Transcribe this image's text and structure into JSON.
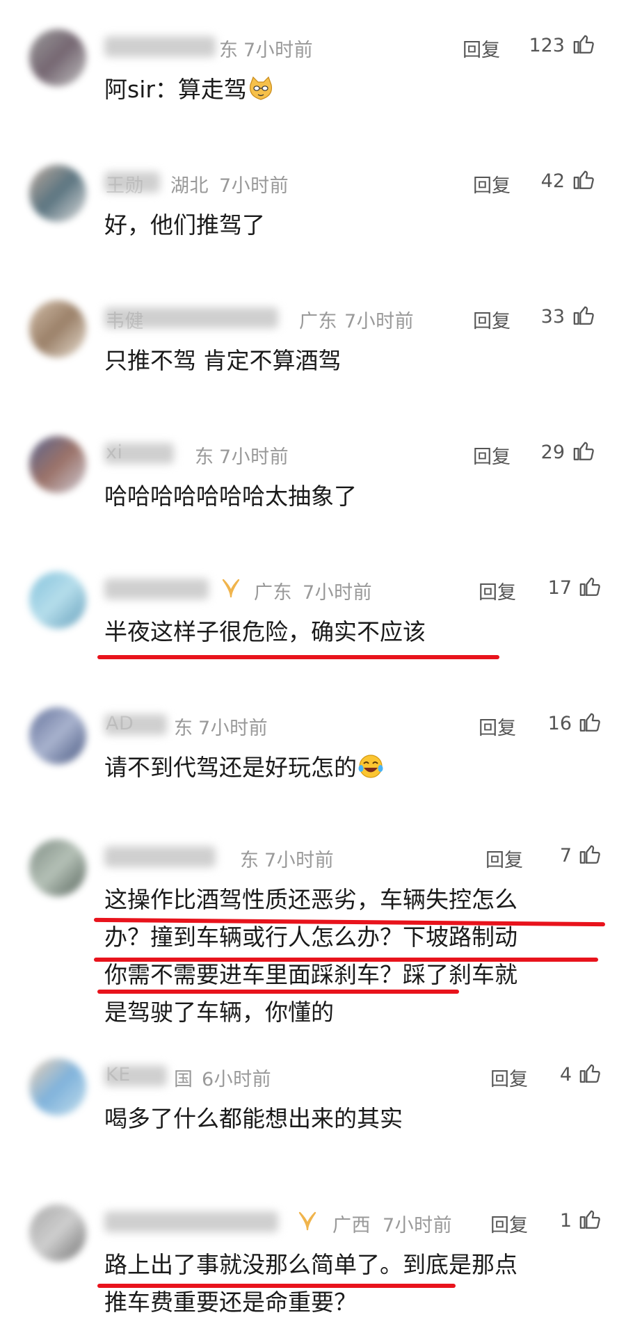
{
  "reply_label": "回复",
  "comments": [
    {
      "region": "东",
      "time": "7小时前",
      "likes": "123",
      "text": "阿sir：算走驾"
    },
    {
      "name_part": "王勋",
      "region": "湖北",
      "time": "7小时前",
      "likes": "42",
      "text": "好，他们推驾了"
    },
    {
      "name_part": "韦健",
      "region": "广东",
      "time": "7小时前",
      "likes": "33",
      "text": "只推不驾 肯定不算酒驾"
    },
    {
      "name_part": "xi",
      "region": "东",
      "time": "7小时前",
      "likes": "29",
      "text": "哈哈哈哈哈哈哈太抽象了"
    },
    {
      "region": "广东",
      "time": "7小时前",
      "likes": "17",
      "text": "半夜这样子很危险，确实不应该",
      "badge_icon": "vip-badge-icon"
    },
    {
      "name_part": "AD",
      "region": "东",
      "time": "7小时前",
      "likes": "16",
      "text": "请不到代驾还是好玩怎的"
    },
    {
      "region": "东",
      "time": "7小时前",
      "likes": "7",
      "text_lines": [
        "这操作比酒驾性质还恶劣，车辆失控怎么",
        "办？撞到车辆或行人怎么办？下坡路制动",
        "你需不需要进车里面踩刹车？踩了刹车就",
        "是驾驶了车辆，你懂的"
      ]
    },
    {
      "name_part": "KE",
      "region": "国",
      "time": "6小时前",
      "likes": "4",
      "text": "喝多了什么都能想出来的其实"
    },
    {
      "region": "广西",
      "time": "7小时前",
      "likes": "1",
      "text_lines": [
        "路上出了事就没那么简单了。到底是那点",
        "推车费重要还是命重要？"
      ],
      "badge_icon": "vip-badge-icon"
    }
  ],
  "colors": {
    "underline": "#e8131c",
    "meta": "#999999",
    "text": "#1a1a1a"
  }
}
